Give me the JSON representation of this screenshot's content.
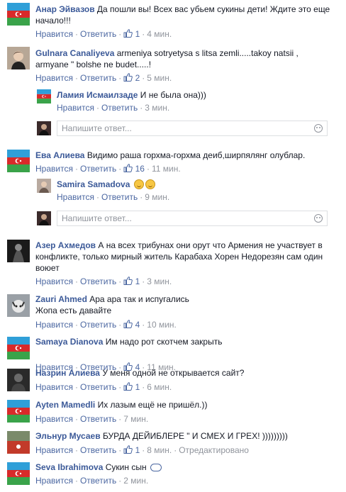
{
  "labels": {
    "like": "Нравится",
    "reply": "Ответить",
    "sep": "·",
    "placeholder": "Напишите ответ..."
  },
  "comments": [
    {
      "author": "Анар Эйвазов",
      "text": "Да пошли вы! Всех вас убьем сукины дети! Ждите это еще начало!!!",
      "likes": "1",
      "time": "4 мин."
    },
    {
      "author": "Gulnara Canaliyeva",
      "text": "armeniya sotryetysa s litsa zemli.....takoy natsii , armyane \" bolshe ne budet.....!",
      "likes": "2",
      "time": "5 мин."
    },
    {
      "author": "Ламия Исмаилзаде",
      "text": "И не была она)))",
      "time": "3 мин."
    },
    {
      "author": "Ева Алиева",
      "text": "Видимо раша горхма-горхма деиб,ширпялянг олублар.",
      "likes": "16",
      "time": "11 мин."
    },
    {
      "author": "Samira Samadova",
      "text": "",
      "time": "9 мин."
    },
    {
      "author": "Азер Ахмедов",
      "text": "А на всех трибунах они орут что Армения не участвует в конфликте, только мирный житель Карабаха Хорен Недорезян сам один воюет",
      "likes": "1",
      "time": "3 мин."
    },
    {
      "author": "Zauri Ahmed",
      "text_line1": "Ара ара так и испугались",
      "text_line2": "Жопа есть давайте",
      "likes": "4",
      "time": "10 мин."
    },
    {
      "author": "Samaya Dianova",
      "text": "Им надо рот скотчем закрыть",
      "likes": "4",
      "time": "11 мин."
    },
    {
      "author": "Назрин Алиева",
      "text": "У меня одной не открывается сайт?",
      "likes": "1",
      "time": "6 мин."
    },
    {
      "author": "Ayten Mamedli",
      "text": "Их лазым ещё не пришёл.))",
      "time": "7 мин."
    },
    {
      "author": "Эльнур Мусаев",
      "text": "БУРДА ДЕЙИБЛЕРЕ \" И СМЕХ И ГРЕХ! )))))))))",
      "likes": "1",
      "time": "8 мин.",
      "edited": "Отредактировано"
    },
    {
      "author": "Seva Ibrahimova",
      "text": "Сукин сын",
      "time": "2 мин."
    }
  ],
  "colors": {
    "link": "#4b67a1",
    "author": "#3b5998",
    "meta": "#90949c"
  }
}
